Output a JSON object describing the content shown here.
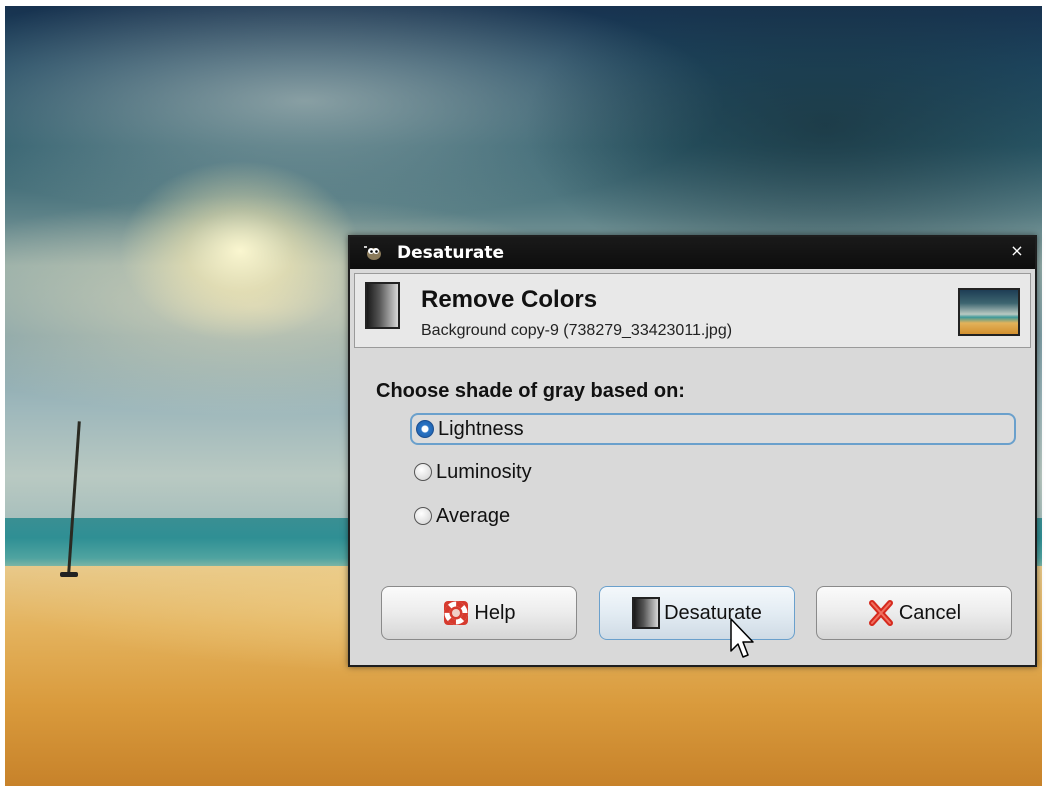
{
  "dialog": {
    "title": "Desaturate",
    "close_glyph": "×",
    "header": {
      "title": "Remove Colors",
      "subtitle": "Background copy-9 (738279_33423011.jpg)"
    },
    "section_label": "Choose shade of gray based on:",
    "options": [
      {
        "label": "Lightness",
        "checked": true
      },
      {
        "label": "Luminosity",
        "checked": false
      },
      {
        "label": "Average",
        "checked": false
      }
    ],
    "buttons": {
      "help": "Help",
      "desaturate": "Desaturate",
      "cancel": "Cancel"
    }
  },
  "icons": {
    "title": "gimp-wilber-icon",
    "close": "close-icon",
    "header": "desaturate-gradient-icon",
    "thumbnail": "image-thumbnail",
    "help": "lifebuoy-icon",
    "desaturate": "desaturate-gradient-icon",
    "cancel": "red-x-icon"
  },
  "colors": {
    "titlebar": "#111111",
    "dialog_bg": "#d9d9d9",
    "focus_ring": "#6aa0cc",
    "radio_checked": "#1a5aa6",
    "cancel_x": "#d62a1e",
    "help_lifebuoy": "#d63a2e"
  }
}
